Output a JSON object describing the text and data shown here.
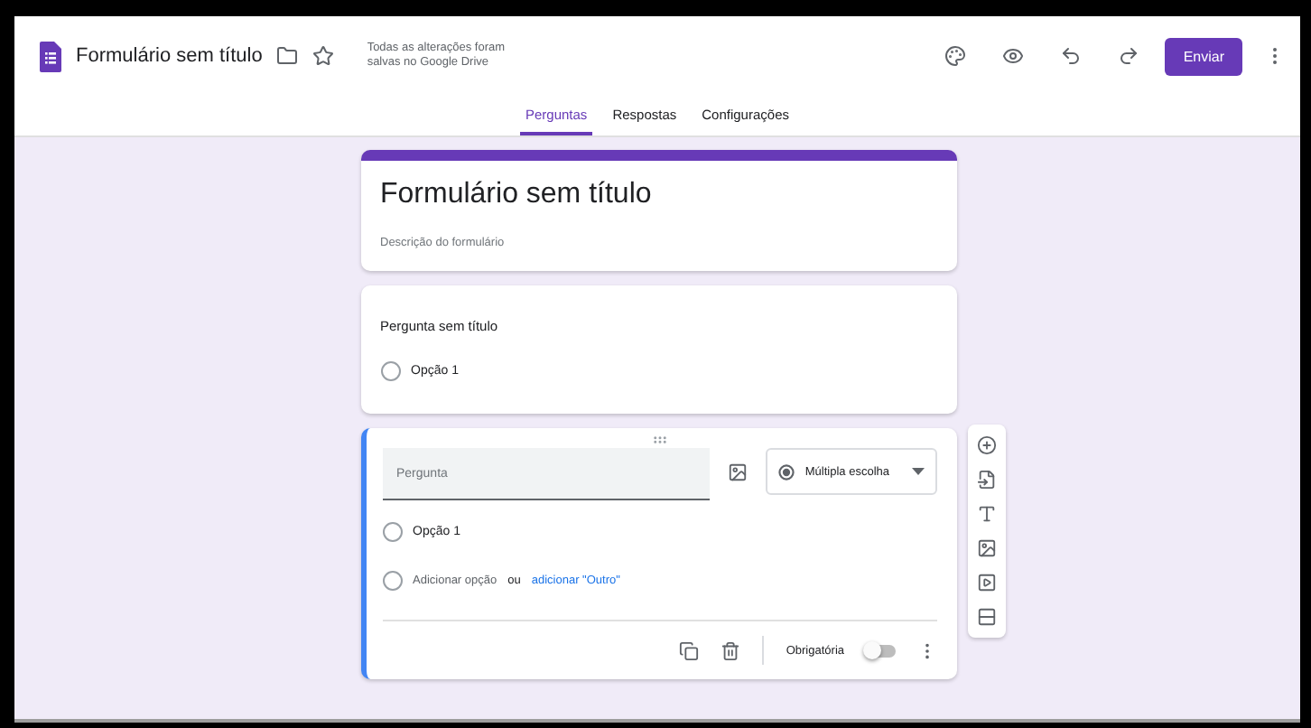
{
  "header": {
    "title": "Formulário sem título",
    "save_status": "Todas as alterações foram salvas no Google Drive",
    "send_button": "Enviar"
  },
  "tabs": [
    {
      "label": "Perguntas",
      "selected": true
    },
    {
      "label": "Respostas",
      "selected": false
    },
    {
      "label": "Configurações",
      "selected": false
    }
  ],
  "form": {
    "title": "Formulário sem título",
    "description": "Descrição do formulário"
  },
  "questions": [
    {
      "kind": "preview",
      "title": "Pergunta sem título",
      "options": [
        "Opção 1"
      ]
    },
    {
      "kind": "editing",
      "placeholder": "Pergunta",
      "type": "Múltipla escolha",
      "options": [
        "Opção 1"
      ],
      "add_option": "Adicionar opção",
      "or": "ou",
      "add_other": "adicionar \"Outro\"",
      "required_label": "Obrigatória",
      "required": false
    }
  ]
}
